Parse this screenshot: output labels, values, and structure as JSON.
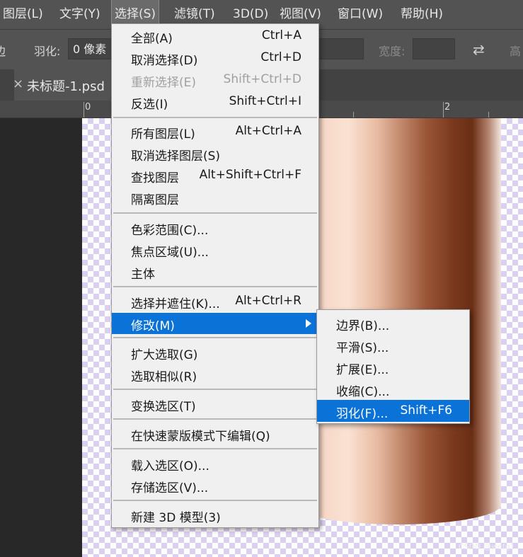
{
  "menubar": {
    "items": [
      {
        "label": "图层(L)"
      },
      {
        "label": "文字(Y)"
      },
      {
        "label": "选择(S)"
      },
      {
        "label": "滤镜(T)"
      },
      {
        "label": "3D(D)"
      },
      {
        "label": "视图(V)"
      },
      {
        "label": "窗口(W)"
      },
      {
        "label": "帮助(H)"
      }
    ]
  },
  "options": {
    "left_glyph": "边",
    "feather_label": "羽化:",
    "feather_value": "0 像素",
    "width_label": "宽度:",
    "height_label": "高",
    "swap_icon": "swap-arrows-icon"
  },
  "tab": {
    "close": "×",
    "title": "未标题-1.psd"
  },
  "ruler": {
    "labels": [
      "0",
      "2"
    ]
  },
  "select_menu": {
    "items": [
      {
        "label": "全部(A)",
        "shortcut": "Ctrl+A",
        "disabled": false
      },
      {
        "label": "取消选择(D)",
        "shortcut": "Ctrl+D",
        "disabled": false
      },
      {
        "label": "重新选择(E)",
        "shortcut": "Shift+Ctrl+D",
        "disabled": true
      },
      {
        "label": "反选(I)",
        "shortcut": "Shift+Ctrl+I",
        "disabled": false
      },
      {
        "label": "所有图层(L)",
        "shortcut": "Alt+Ctrl+A",
        "disabled": false
      },
      {
        "label": "取消选择图层(S)",
        "shortcut": "",
        "disabled": false
      },
      {
        "label": "查找图层",
        "shortcut": "Alt+Shift+Ctrl+F",
        "disabled": false
      },
      {
        "label": "隔离图层",
        "shortcut": "",
        "disabled": false
      },
      {
        "label": "色彩范围(C)...",
        "shortcut": "",
        "disabled": false
      },
      {
        "label": "焦点区域(U)...",
        "shortcut": "",
        "disabled": false
      },
      {
        "label": "主体",
        "shortcut": "",
        "disabled": false
      },
      {
        "label": "选择并遮住(K)...",
        "shortcut": "Alt+Ctrl+R",
        "disabled": false
      },
      {
        "label": "修改(M)",
        "shortcut": "",
        "disabled": false,
        "highlighted": true,
        "has_submenu": true
      },
      {
        "label": "扩大选取(G)",
        "shortcut": "",
        "disabled": false
      },
      {
        "label": "选取相似(R)",
        "shortcut": "",
        "disabled": false
      },
      {
        "label": "变换选区(T)",
        "shortcut": "",
        "disabled": false
      },
      {
        "label": "在快速蒙版模式下编辑(Q)",
        "shortcut": "",
        "disabled": false
      },
      {
        "label": "载入选区(O)...",
        "shortcut": "",
        "disabled": false
      },
      {
        "label": "存储选区(V)...",
        "shortcut": "",
        "disabled": false
      },
      {
        "label": "新建 3D 模型(3)",
        "shortcut": "",
        "disabled": false
      }
    ]
  },
  "modify_submenu": {
    "items": [
      {
        "label": "边界(B)...",
        "shortcut": ""
      },
      {
        "label": "平滑(S)...",
        "shortcut": ""
      },
      {
        "label": "扩展(E)...",
        "shortcut": ""
      },
      {
        "label": "收缩(C)...",
        "shortcut": ""
      },
      {
        "label": "羽化(F)...",
        "shortcut": "Shift+F6",
        "highlighted": true
      }
    ]
  },
  "watermark": "CSDN @wefg1",
  "colors": {
    "highlight": "#0b72d8",
    "menu_bg": "#f0f0f0",
    "app_bg": "#535353",
    "checker": "#dcd0f2"
  }
}
